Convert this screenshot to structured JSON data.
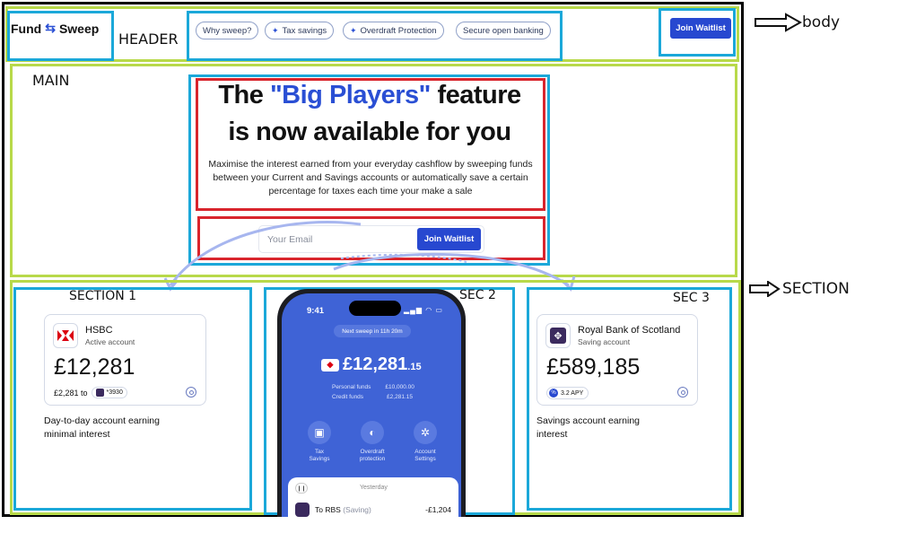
{
  "header": {
    "logo_left": "Fund",
    "logo_right": "Sweep",
    "nav": [
      "Why sweep?",
      "Tax savings",
      "Overdraft Protection",
      "Secure open banking"
    ],
    "cta": "Join Waitlist"
  },
  "hero": {
    "headline_prefix": "The ",
    "headline_accent": "\"Big Players\"",
    "headline_suffix": " feature",
    "headline_line2": "is now available for you",
    "subtext": "Maximise the interest earned from your everyday cashflow by sweeping funds between your Current and Savings accounts or automatically save a certain percentage for taxes each time your make a sale",
    "email_placeholder": "Your Email",
    "cta": "Join Waitlist"
  },
  "cards": {
    "hsbc": {
      "name": "HSBC",
      "status": "Active account",
      "amount": "£12,281",
      "foot_text": "£2,281 to",
      "foot_tag": "*3930",
      "description": "Day-to-day account earning minimal interest"
    },
    "rbs": {
      "name": "Royal Bank of Scotland",
      "status": "Saving account",
      "amount": "£589,185",
      "apy": "3.2 APY",
      "description": "Savings account earning interest"
    }
  },
  "phone": {
    "time": "9:41",
    "status_icons": "▂▄▆ ◠ ▭",
    "next_sweep": "Next sweep in 11h 20m",
    "amount_main": "£12,281",
    "amount_dec": ".15",
    "personal_label": "Personal funds",
    "personal_value": "£10,000.00",
    "credit_label": "Credit funds",
    "credit_value": "£2,281.15",
    "actions": [
      {
        "line1": "Tax",
        "line2": "Savings"
      },
      {
        "line1": "Overdraft",
        "line2": "protection"
      },
      {
        "line1": "Account",
        "line2": "Settings"
      }
    ],
    "day_label": "Yesterday",
    "tx_name": "To RBS",
    "tx_tag": "(Saving)",
    "tx_amount": "-£1,204"
  },
  "annotations": {
    "body": "body",
    "header": "HEADER",
    "main": "MAIN",
    "section1": "SECTION 1",
    "sec2": "SEC 2",
    "sec3": "SEC 3",
    "section": "SECTION"
  },
  "colors": {
    "brand_blue": "#2748d0",
    "annotation_green": "#b8d94a",
    "annotation_cyan": "#1ba8d9",
    "annotation_red": "#d9252d"
  }
}
